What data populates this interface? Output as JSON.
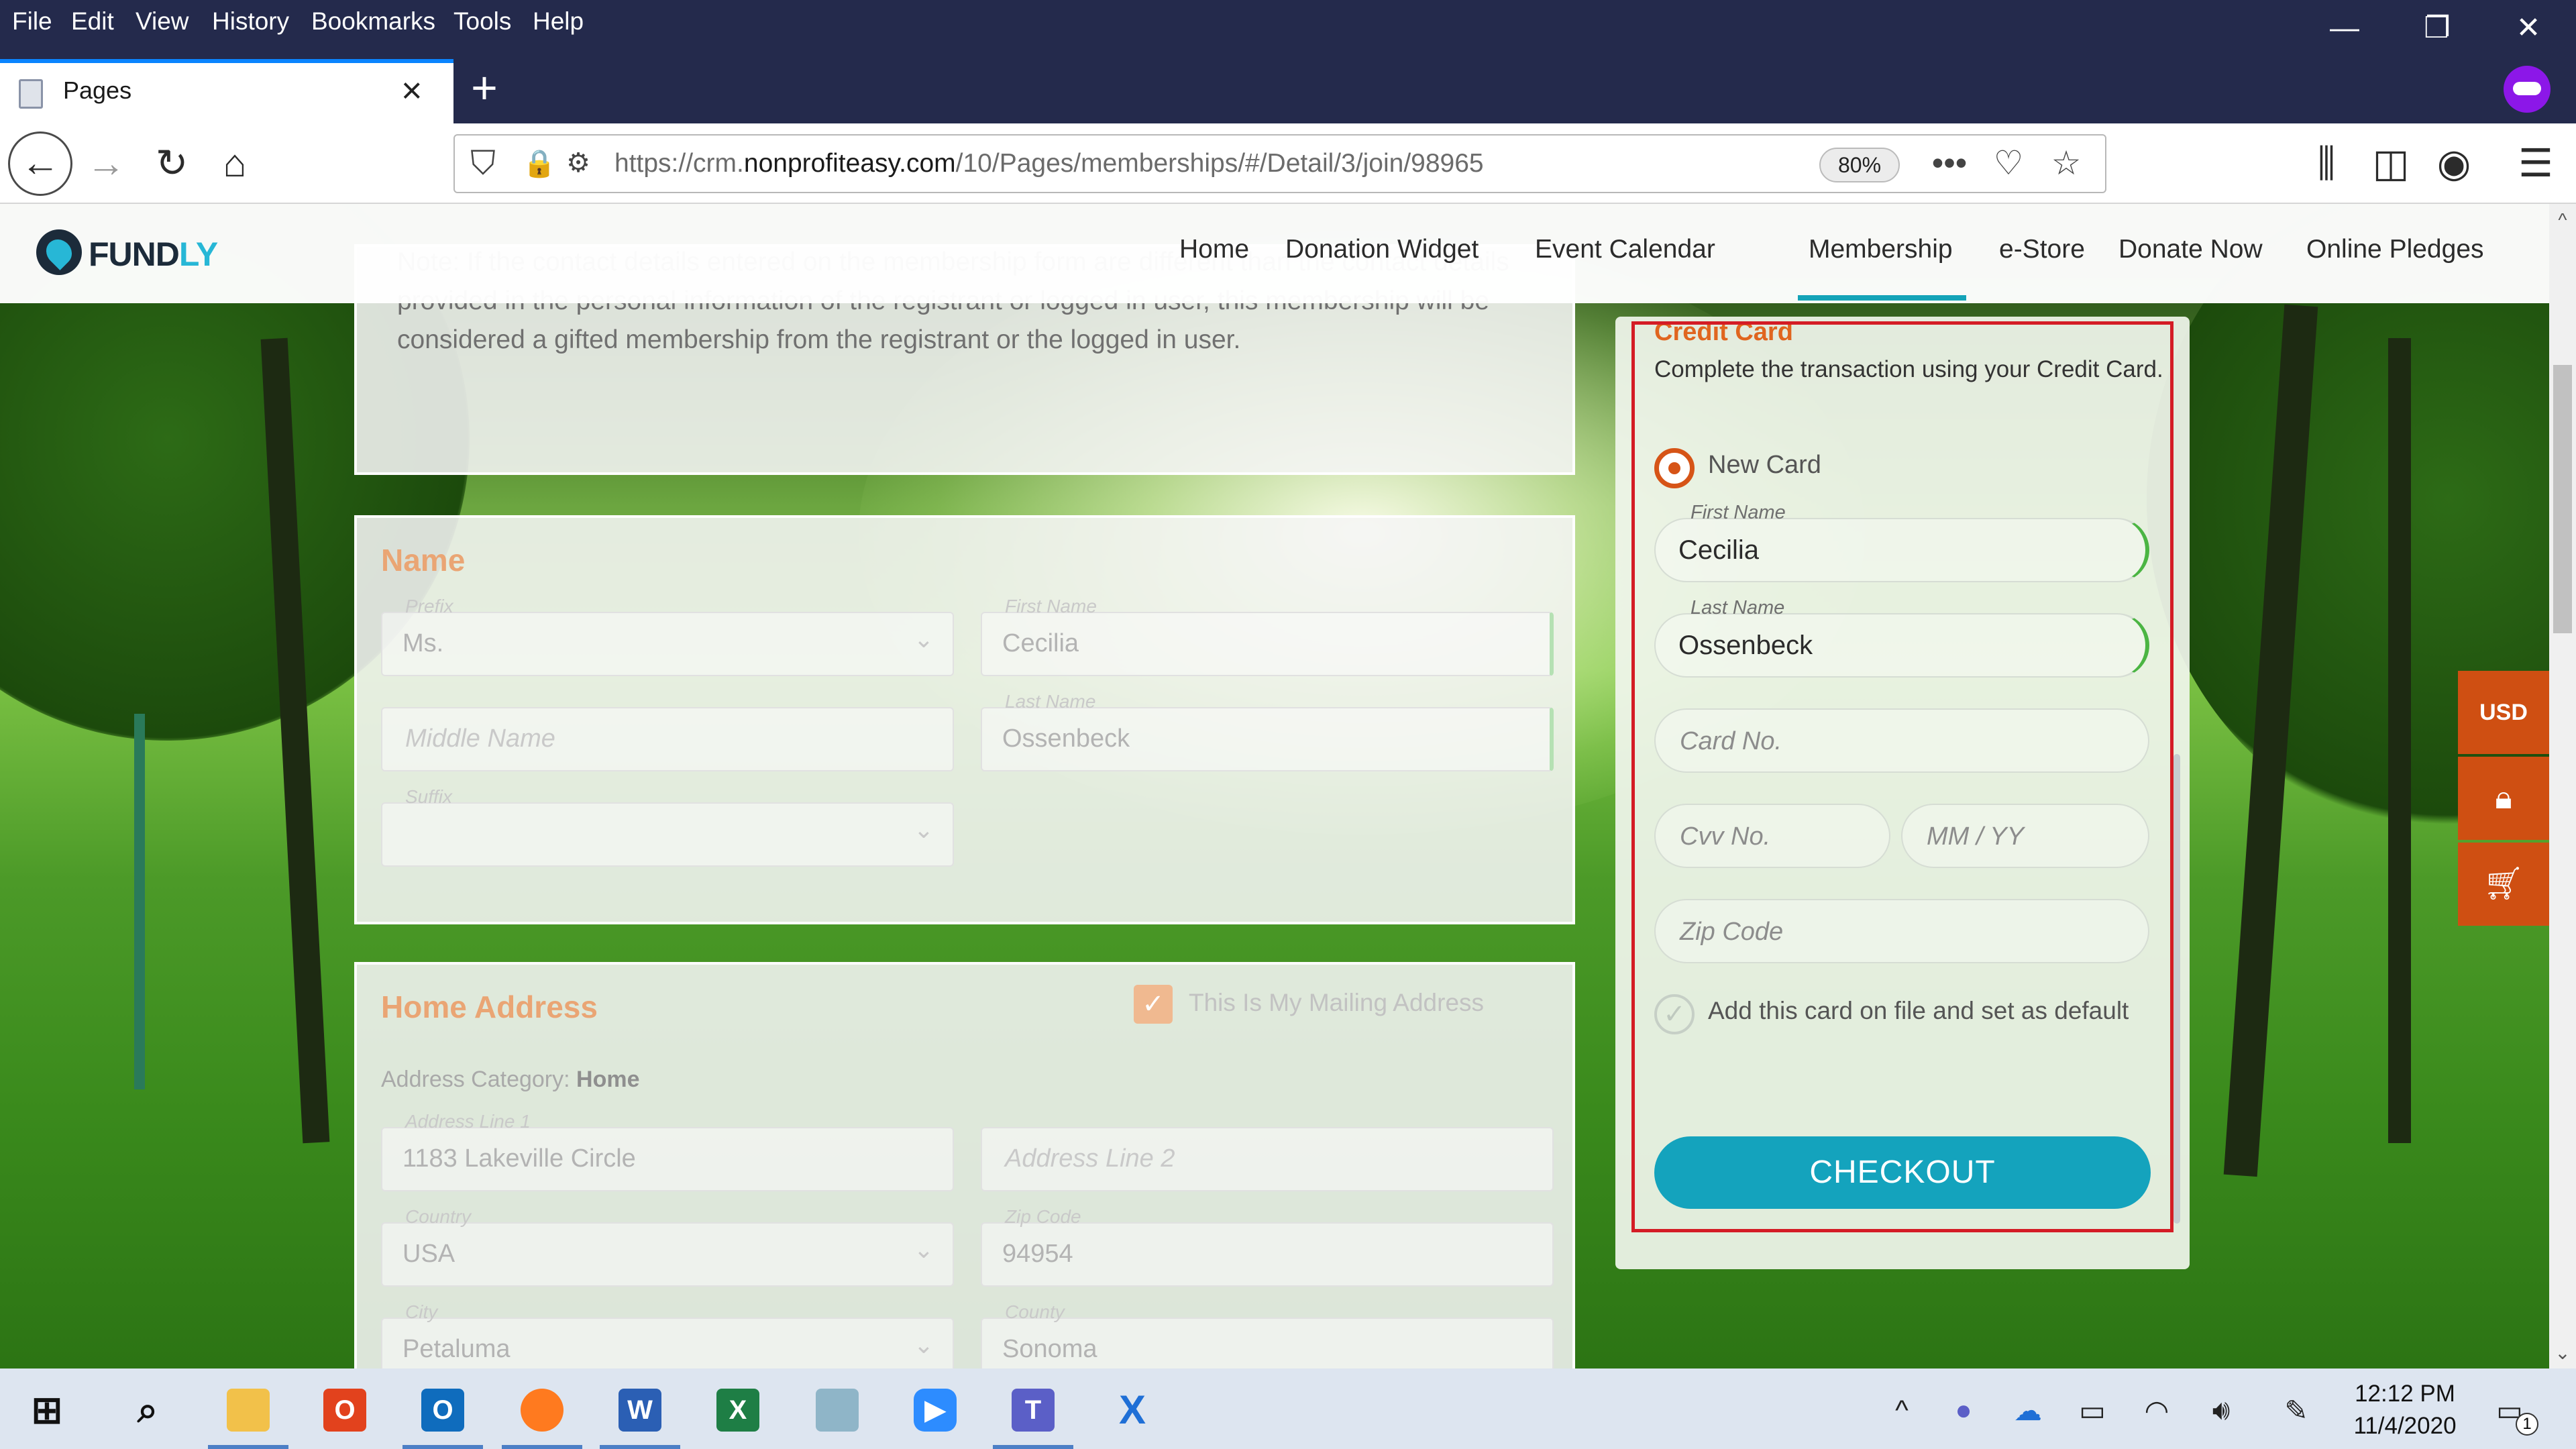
{
  "browser": {
    "menu": [
      "File",
      "Edit",
      "View",
      "History",
      "Bookmarks",
      "Tools",
      "Help"
    ],
    "tab_title": "Pages",
    "url_prefix": "https://crm.",
    "url_domain": "nonprofiteasy.com",
    "url_path": "/10/Pages/memberships/#/Detail/3/join/98965",
    "zoom": "80%"
  },
  "site": {
    "logo_a": "FUND",
    "logo_b": "LY",
    "nav": [
      "Home",
      "Donation Widget",
      "Event Calendar",
      "Membership",
      "e-Store",
      "Donate Now",
      "Online Pledges"
    ],
    "active_nav": "Membership"
  },
  "note": {
    "text": "Note: If the contact details entered on the membership form are different than the contact details provided in the personal information of the registrant or logged in user, this membership will be considered a gifted membership from the registrant or the logged in user."
  },
  "name_section": {
    "title": "Name",
    "prefix_label": "Prefix",
    "prefix_value": "Ms.",
    "first_label": "First Name",
    "first_value": "Cecilia",
    "middle_placeholder": "Middle Name",
    "last_label": "Last Name",
    "last_value": "Ossenbeck",
    "suffix_label": "Suffix"
  },
  "address_section": {
    "title": "Home Address",
    "mailing_label": "This Is My Mailing Address",
    "category_label": "Address Category:",
    "category_value": "Home",
    "line1_label": "Address Line 1",
    "line1_value": "1183 Lakeville Circle",
    "line2_placeholder": "Address Line 2",
    "country_label": "Country",
    "country_value": "USA",
    "zip_label": "Zip Code",
    "zip_value": "94954",
    "city_label": "City",
    "city_value": "Petaluma",
    "county_label": "County",
    "county_value": "Sonoma"
  },
  "credit_card": {
    "title": "Credit Card",
    "description": "Complete the transaction using your Credit Card.",
    "new_card_label": "New Card",
    "first_label": "First Name",
    "first_value": "Cecilia",
    "last_label": "Last Name",
    "last_value": "Ossenbeck",
    "card_placeholder": "Card No.",
    "cvv_placeholder": "Cvv No.",
    "expiry_placeholder": "MM / YY",
    "zip_placeholder": "Zip Code",
    "save_label": "Add this card on file and set as default",
    "checkout_label": "CHECKOUT"
  },
  "side_tabs": {
    "currency": "USD"
  },
  "taskbar": {
    "time": "12:12 PM",
    "date": "11/4/2020",
    "notification_count": "1"
  },
  "colors": {
    "accent": "#14a3bd",
    "brand_orange": "#cf4f12",
    "highlight": "#d41c25",
    "browser_dark": "#242a4c"
  }
}
